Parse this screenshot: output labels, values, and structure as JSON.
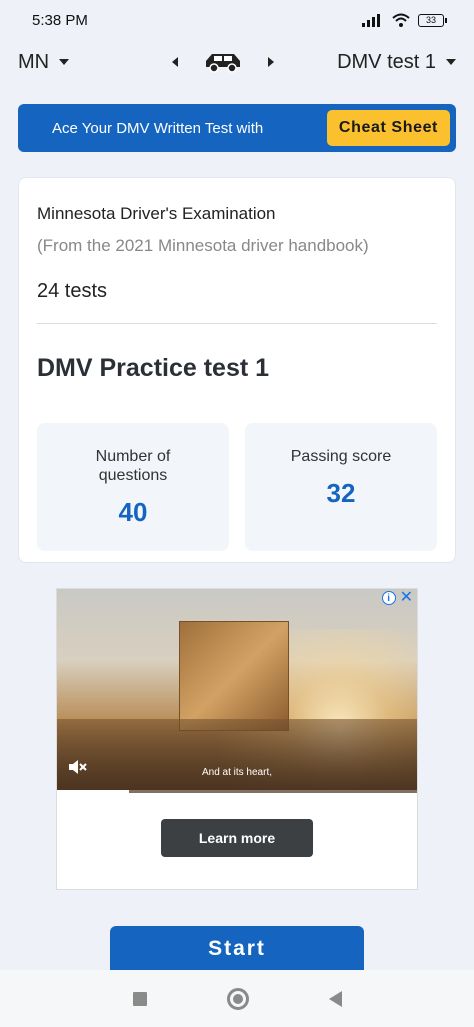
{
  "status_bar": {
    "time": "5:38 PM",
    "battery": "33"
  },
  "topnav": {
    "state": "MN",
    "test": "DMV test 1"
  },
  "promo": {
    "text": "Ace Your DMV Written Test with",
    "button": "Cheat Sheet"
  },
  "card": {
    "exam_title": "Minnesota Driver's Examination",
    "exam_source": "(From the 2021 Minnesota driver handbook)",
    "test_count": "24 tests",
    "practice_title": "DMV Practice test 1",
    "stats": [
      {
        "label": "Number of questions",
        "value": "40"
      },
      {
        "label": "Passing score",
        "value": "32"
      }
    ]
  },
  "ad": {
    "caption": "And at its heart,",
    "button": "Learn more",
    "video_progress": 0.2
  },
  "start": {
    "label": "Start"
  },
  "colors": {
    "accent": "#1565c0",
    "cheat_sheet": "#fbc02d"
  }
}
